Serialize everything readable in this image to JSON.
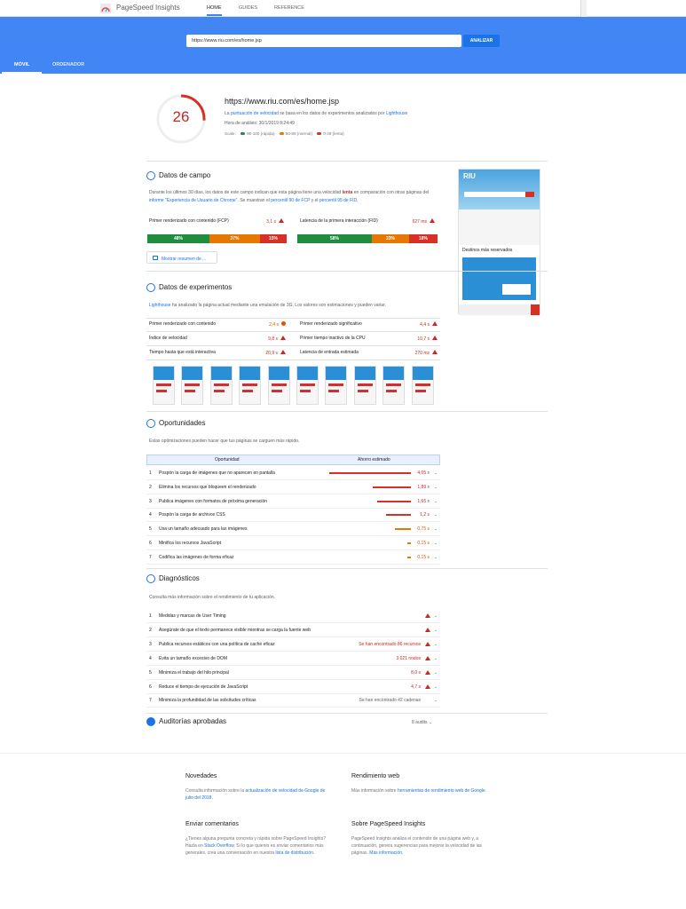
{
  "app": {
    "title": "PageSpeed Insights"
  },
  "nav": [
    "HOME",
    "GUIDES",
    "REFERENCE"
  ],
  "search": {
    "url": "https://www.riu.com/es/home.jsp",
    "button": "ANALIZAR"
  },
  "tabs": [
    "MÓVIL",
    "ORDENADOR"
  ],
  "summary": {
    "score": "26",
    "url": "https://www.riu.com/es/home.jsp",
    "line1a": "La ",
    "line1link": "puntuación de velocidad",
    "line1b": " se basa en los datos de experimentos analizados por ",
    "line1link2": "Lighthouse",
    "date": "Hora de análisis: 30/1/2019 8:24:49",
    "scale_label": "Scale:",
    "scale": [
      "90-100 (rápida)",
      "50-89 (normal)",
      "0-49 (lenta)"
    ]
  },
  "colors": {
    "green": "#1e8e3e",
    "orange": "#e67700",
    "red": "#d93025",
    "blue": "#4285f4"
  },
  "field": {
    "title": "Datos de campo",
    "desc1": "Durante los últimos 30 días, los datos de este campo indican que esta página tiene una velocidad ",
    "slow": "lenta",
    "desc2": " en comparación con",
    "desc3": "otras páginas del ",
    "desc_link": "informe \"Experiencia de Usuario de Chrome\"",
    "desc4": ". Se muestran el ",
    "p90": "percentil 90 de FCP",
    "desc5": " y el ",
    "p95": "percentil 95 de FID",
    "desc6": ".",
    "fcp_label": "Primer renderizado con contenido (FCP)",
    "fcp_val": "3,1 s",
    "fid_label": "Latencia de la primera interacción (FID)",
    "fid_val": "627 ms",
    "fcp_dist": [
      "48%",
      "37%",
      "15%"
    ],
    "fid_dist": [
      "58%",
      "23%",
      "18%"
    ],
    "button": "Mostrar resumen de ..."
  },
  "lab": {
    "title": "Datos de experimentos",
    "link": "Lighthouse",
    "desc": " ha analizado la página actual mediante una emulación de 3G. Los valores son estimaciones y pueden variar.",
    "metrics": [
      {
        "label": "Primer renderizado con contenido",
        "value": "2,4 s"
      },
      {
        "label": "Primer renderizado significativo",
        "value": "4,4 s"
      },
      {
        "label": "Índice de velocidad",
        "value": "9,8 s"
      },
      {
        "label": "Primer tiempo inactivo de la CPU",
        "value": "10,7 s"
      },
      {
        "label": "Tiempo hasta que está interactiva",
        "value": "20,9 s"
      },
      {
        "label": "Latencia de entrada estimada",
        "value": "270 ms"
      }
    ]
  },
  "opportunities": {
    "title": "Oportunidades",
    "desc": "Estas optimizaciones pueden hacer que tus páginas se carguen más rápido.",
    "col1": "Oportunidad",
    "col2": "Ahorro estimado",
    "items": [
      {
        "n": "1",
        "label": "Pospón la carga de imágenes que no aparecen en pantalla",
        "value": "4,05 s"
      },
      {
        "n": "2",
        "label": "Elimina los recursos que bloqueen el renderizado",
        "value": "1,89 s"
      },
      {
        "n": "3",
        "label": "Publica imágenes con formatos de próxima generación",
        "value": "1,65 s"
      },
      {
        "n": "4",
        "label": "Pospón la carga de archivos CSS",
        "value": "1,2 s"
      },
      {
        "n": "5",
        "label": "Usa un tamaño adecuado para las imágenes",
        "value": "0,75 s"
      },
      {
        "n": "6",
        "label": "Minifica los recursos JavaScript",
        "value": "0,15 s"
      },
      {
        "n": "7",
        "label": "Codifica las imágenes de forma eficaz",
        "value": "0,15 s"
      }
    ]
  },
  "diagnostics": {
    "title": "Diagnósticos",
    "desc": "Consulta más información sobre el rendimiento de tu aplicación.",
    "items": [
      {
        "n": "1",
        "label": "Medidas y marcas de User Timing",
        "value": ""
      },
      {
        "n": "2",
        "label": "Asegúrate de que el texto permanece visible mientras se carga la fuente web",
        "value": ""
      },
      {
        "n": "3",
        "label": "Publica recursos estáticos con una política de caché eficaz",
        "value": "Se han encontrado 86 recursos"
      },
      {
        "n": "4",
        "label": "Evita un tamaño excesivo de DOM",
        "value": "3.021 nodos"
      },
      {
        "n": "5",
        "label": "Minimiza el trabajo del hilo principal",
        "value": "8,0 s"
      },
      {
        "n": "6",
        "label": "Reduce el tiempo de ejecución de JavaScript",
        "value": "4,7 s"
      },
      {
        "n": "7",
        "label": "Minimiza la profundidad de las solicitudes críticas",
        "value": "Se han encontrado 42 cadenas"
      }
    ]
  },
  "passed": {
    "title": "Auditorías aprobadas",
    "count": "8 audits"
  },
  "shot": {
    "brand": "RIU",
    "heading": "Destinos más reservados"
  },
  "footer": {
    "c1t": "Novedades",
    "c1a": "Consulta información sobre la ",
    "c1l": "actualización de velocidad de Google de julio del 2018",
    "c1b": ".",
    "c2t": "Rendimiento web",
    "c2a": "Más información sobre ",
    "c2l": "herramientas de rendimiento web de Google",
    "c2b": ".",
    "c3t": "Enviar comentarios",
    "c3a": "¿Tienes alguna pregunta concreta y rápida sobre PageSpeed Insights? Hazla en ",
    "c3l": "Stack Overflow",
    "c3b": ". Si lo que quieres es enviar comentarios más generales, crea una conversación en nuestra ",
    "c3l2": "lista de distribución",
    "c3c": ".",
    "c4t": "Sobre PageSpeed Insights",
    "c4a": "PageSpeed Insights analiza el contenido de una página web y, a continuación, genera sugerencias para mejorar la velocidad de las páginas. ",
    "c4l": "Más información",
    "c4b": "."
  }
}
